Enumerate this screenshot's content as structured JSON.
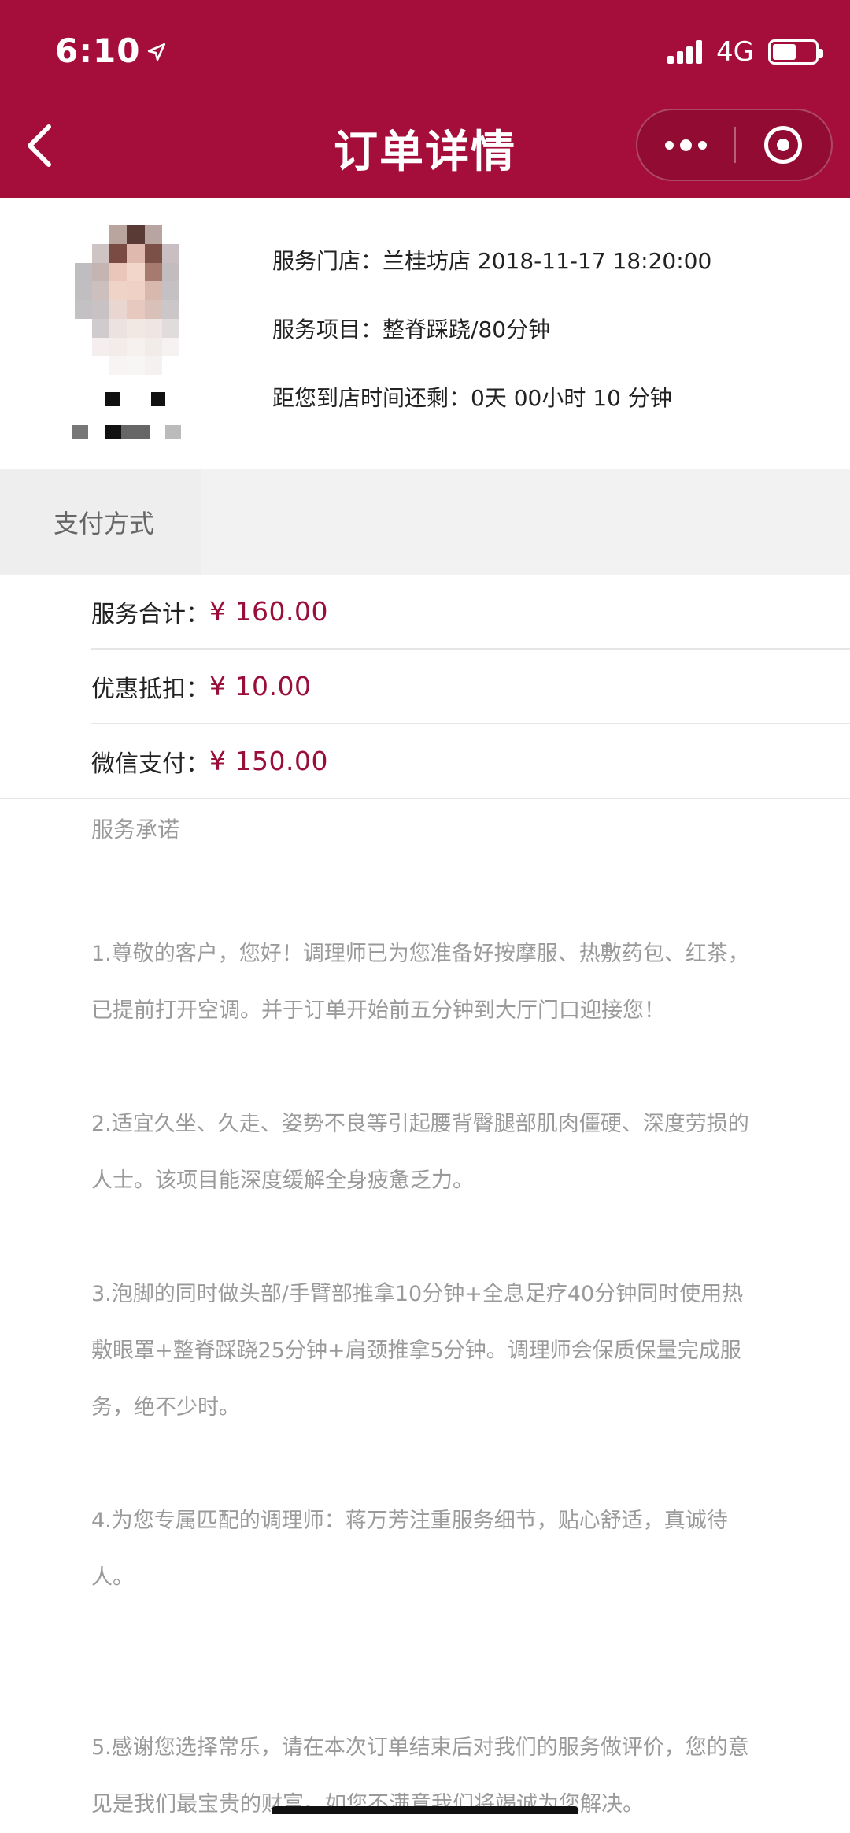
{
  "status_bar": {
    "time": "6:10",
    "network": "4G",
    "battery_level": 0.55
  },
  "nav": {
    "title": "订单详情",
    "back_icon": "chevron-left-icon",
    "more_icon": "more-dots-icon",
    "close_icon": "target-circle-icon"
  },
  "order": {
    "store_label": "服务门店：",
    "store_value": "兰桂坊店 2018-11-17 18:20:00",
    "item_label": "服务项目：",
    "item_value": "整脊踩跷/80分钟",
    "countdown_label": "距您到店时间还剩：",
    "countdown_value": "0天 00小时 10 分钟"
  },
  "payment": {
    "section_title": "支付方式",
    "rows": [
      {
        "label": "服务合计：",
        "amount": "¥ 160.00"
      },
      {
        "label": "优惠抵扣：",
        "amount": "¥ 10.00"
      },
      {
        "label": "微信支付：",
        "amount": "¥ 150.00"
      }
    ]
  },
  "promise": {
    "title": "服务承诺",
    "paragraphs": [
      "1.尊敬的客户，您好！调理师已为您准备好按摩服、热敷药包、红茶，已提前打开空调。并于订单开始前五分钟到大厅门口迎接您！",
      "2.适宜久坐、久走、姿势不良等引起腰背臀腿部肌肉僵硬、深度劳损的人士。该项目能深度缓解全身疲惫乏力。",
      "3.泡脚的同时做头部/手臂部推拿10分钟+全息足疗40分钟同时使用热敷眼罩+整脊踩跷25分钟+肩颈推拿5分钟。调理师会保质保量完成服务，绝不少时。",
      "4.为您专属匹配的调理师：蒋万芳注重服务细节，贴心舒适，真诚待人。",
      "5.感谢您选择常乐，请在本次订单结束后对我们的服务做评价，您的意见是我们最宝贵的财富。如您不满意我们将竭诚为您解决。"
    ]
  },
  "colors": {
    "brand": "#a50d3a",
    "price": "#9a0f3a"
  }
}
